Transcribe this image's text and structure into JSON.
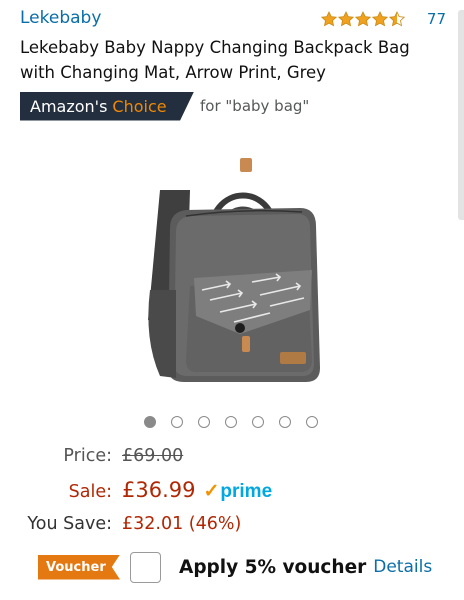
{
  "brand": {
    "name": "Lekebaby"
  },
  "rating": {
    "stars": 4.5,
    "max": 5,
    "count": "77"
  },
  "product": {
    "title": "Lekebaby Baby Nappy Changing Backpack Bag with Changing Mat, Arrow Print, Grey"
  },
  "badge": {
    "label": "Amazon's",
    "accent": "Choice",
    "for_text": "for \"baby bag\""
  },
  "carousel": {
    "total": 7,
    "active": 0
  },
  "pricing": {
    "price_label": "Price:",
    "price_value": "£69.00",
    "sale_label": "Sale:",
    "sale_value": "£36.99",
    "prime_label": "prime",
    "save_label": "You Save:",
    "save_value": "£32.01 (46%)"
  },
  "voucher": {
    "tag": "Voucher",
    "text": "Apply 5% voucher",
    "details": "Details",
    "checked": false
  },
  "colors": {
    "link": "#0a6ea8",
    "price_red": "#b12704",
    "star": "#f0a120",
    "badge_bg": "#232f3e",
    "badge_accent": "#f08804",
    "prime_blue": "#00a8e1",
    "voucher_orange": "#e47911"
  }
}
